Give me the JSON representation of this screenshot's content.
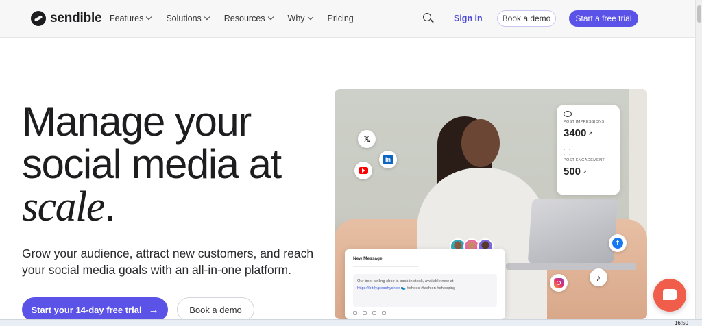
{
  "nav": {
    "brand": "sendible",
    "menu": [
      {
        "label": "Features",
        "dropdown": true
      },
      {
        "label": "Solutions",
        "dropdown": true
      },
      {
        "label": "Resources",
        "dropdown": true
      },
      {
        "label": "Why",
        "dropdown": true
      },
      {
        "label": "Pricing",
        "dropdown": false
      }
    ],
    "sign_in": "Sign in",
    "book_demo": "Book a demo",
    "free_trial": "Start a free trial"
  },
  "hero": {
    "headline_line1": "Manage your",
    "headline_line2": "social media at",
    "headline_italic": "scale",
    "headline_end": ".",
    "subtext": "Grow your audience, attract new customers, and reach your social media goals with an all-in-one platform.",
    "cta_primary": "Start your 14-day free trial",
    "cta_primary_icon": "→",
    "cta_secondary": "Book a demo"
  },
  "stats": {
    "impressions_label": "POST IMPRESSIONS",
    "impressions_value": "3400",
    "engagement_label": "POST ENGAGEMENT",
    "engagement_value": "500",
    "trend_glyph": "↗"
  },
  "social_icons": {
    "x": "𝕏",
    "linkedin": "in",
    "facebook": "f",
    "tiktok": "♪"
  },
  "message_card": {
    "title": "New Message",
    "body": "Our best-selling shoe is back in stock, available now at",
    "link": "https://bit.ly/peachyshoe",
    "tags": "👟 #shoes #fashion #shopping"
  },
  "taskbar": {
    "time": "16:50"
  },
  "colors": {
    "accent": "#5b52e8",
    "chat": "#f05d4a"
  }
}
